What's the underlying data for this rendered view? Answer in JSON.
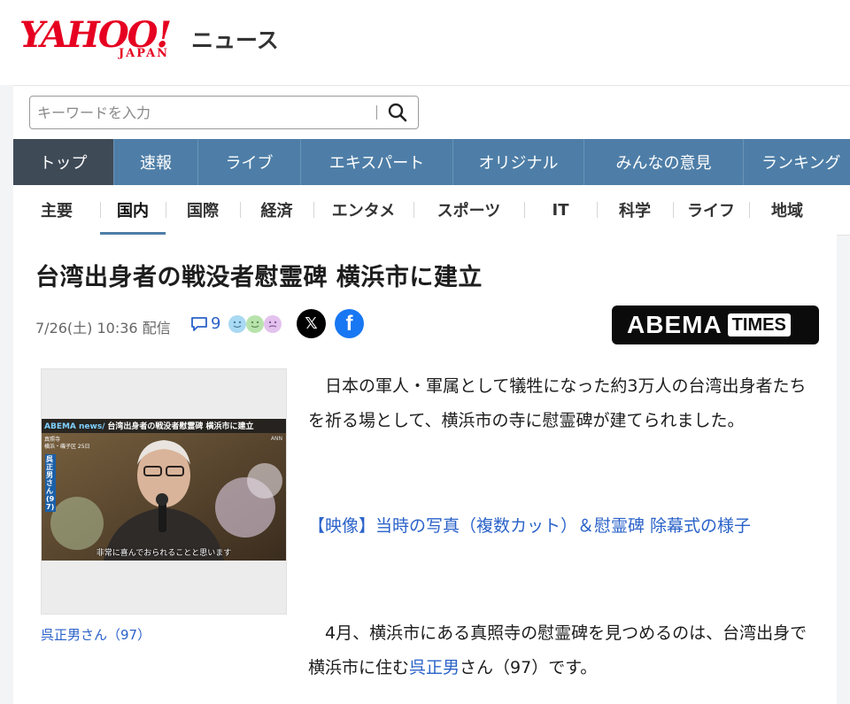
{
  "header": {
    "logo_text": "YAHOO!",
    "logo_sub": "JAPAN",
    "service_name": "ニュース"
  },
  "search": {
    "placeholder": "キーワードを入力",
    "button_icon": "search-icon"
  },
  "global_nav": [
    {
      "label": "トップ",
      "active": true
    },
    {
      "label": "速報",
      "active": false
    },
    {
      "label": "ライブ",
      "active": false
    },
    {
      "label": "エキスパート",
      "active": false
    },
    {
      "label": "オリジナル",
      "active": false
    },
    {
      "label": "みんなの意見",
      "active": false
    },
    {
      "label": "ランキング",
      "active": false
    }
  ],
  "sub_nav": [
    {
      "label": "主要",
      "active": false
    },
    {
      "label": "国内",
      "active": true
    },
    {
      "label": "国際",
      "active": false
    },
    {
      "label": "経済",
      "active": false
    },
    {
      "label": "エンタメ",
      "active": false
    },
    {
      "label": "スポーツ",
      "active": false
    },
    {
      "label": "IT",
      "active": false
    },
    {
      "label": "科学",
      "active": false
    },
    {
      "label": "ライフ",
      "active": false
    },
    {
      "label": "地域",
      "active": false
    }
  ],
  "article": {
    "title": "台湾出身者の戦没者慰霊碑 横浜市に建立",
    "datetime": "7/26(土) 10:36 配信",
    "comment_count": "9",
    "publisher": "ABEMA",
    "publisher_badge": "TIMES",
    "photo": {
      "banner_brand": "ABEMA news/",
      "banner_title": "台湾出身者の戦没者慰霊碑 横浜市に建立",
      "network": "ANN",
      "place_line1": "真照寺",
      "place_line2": "横浜・磯子区 25日",
      "name_tag": "呉 正男さん(97)",
      "subtitle": "非常に喜んでおられることと思います",
      "caption": "呉正男さん（97）"
    },
    "para1": "日本の軍人・軍属として犠牲になった約3万人の台湾出身者たちを祈る場として、横浜市の寺に慰霊碑が建てられました。",
    "link_text": "【映像】当時の写真（複数カット）＆慰霊碑 除幕式の様子",
    "para3_before": "4月、横浜市にある真照寺の慰霊碑を見つめるのは、台湾出身で横浜市に住む",
    "para3_link": "呉正男",
    "para3_after": "さん（97）です。"
  },
  "colors": {
    "brand_red": "#e60021",
    "nav_blue": "#4e7ea7",
    "nav_active": "#3f4a57",
    "link_blue": "#2a62c9"
  }
}
